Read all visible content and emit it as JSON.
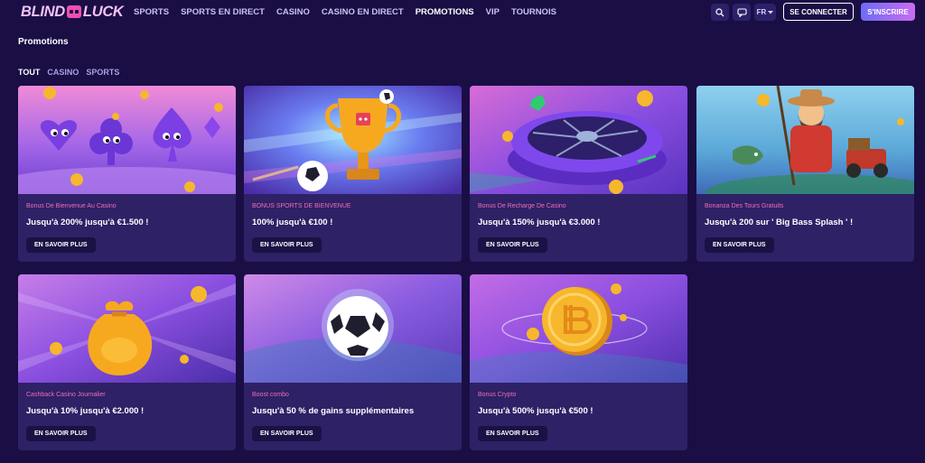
{
  "header": {
    "logo_left": "BLIND",
    "logo_right": "LUCK",
    "nav": [
      "SPORTS",
      "SPORTS EN DIRECT",
      "CASINO",
      "CASINO EN DIRECT",
      "PROMOTIONS",
      "VIP",
      "TOURNOIS"
    ],
    "active_nav": "PROMOTIONS",
    "language": "FR",
    "login_label": "SE CONNECTER",
    "register_label": "S'INSCRIRE"
  },
  "page": {
    "title": "Promotions",
    "filters": [
      "TOUT",
      "CASINO",
      "SPORTS"
    ],
    "active_filter": "TOUT"
  },
  "promotions": [
    {
      "category": "Bonus De Bienvenue Au Casino",
      "title": "Jusqu'à 200% jusqu'à €1.500 !",
      "button": "EN SAVOIR PLUS",
      "art": "card-suits"
    },
    {
      "category": "BONUS SPORTS DE BIENVENUE",
      "title": "100% jusqu'à €100 !",
      "button": "EN SAVOIR PLUS",
      "art": "trophy"
    },
    {
      "category": "Bonus De Recharge De Casino",
      "title": "Jusqu'à 150% jusqu'à €3.000 !",
      "button": "EN SAVOIR PLUS",
      "art": "roulette"
    },
    {
      "category": "Bonanza Des Tours Gratuits",
      "title": "Jusqu'à 200 sur ' Big Bass Splash ' !",
      "button": "EN SAVOIR PLUS",
      "art": "fisherman"
    },
    {
      "category": "Cashback Casino Journalier",
      "title": "Jusqu'à 10% jusqu'à €2.000 !",
      "button": "EN SAVOIR PLUS",
      "art": "money-bag"
    },
    {
      "category": "Boost combo",
      "title": "Jusqu'à 50 % de gains supplémentaires",
      "button": "EN SAVOIR PLUS",
      "art": "soccer-ball"
    },
    {
      "category": "Bonus Crypto",
      "title": "Jusqu'à 500% jusqu'à €500 !",
      "button": "EN SAVOIR PLUS",
      "art": "bitcoin-coin"
    }
  ],
  "colors": {
    "background": "#1a0e45",
    "card": "#2e2166",
    "category_pink": "#f06db9",
    "accent_gold": "#f6b72c"
  }
}
